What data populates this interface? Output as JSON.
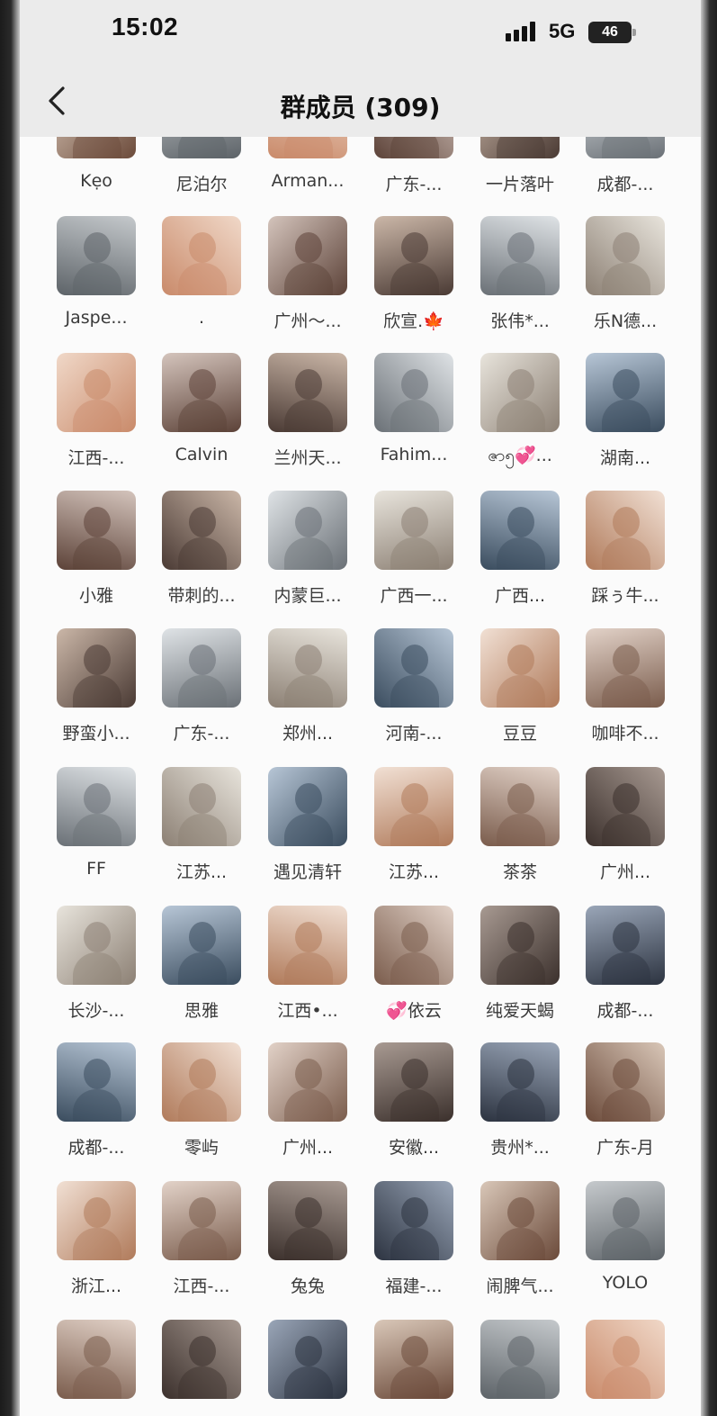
{
  "status_bar": {
    "time": "15:02",
    "network": "5G",
    "battery": "46"
  },
  "header": {
    "title": "群成员 (309)"
  },
  "colors": {
    "header_bg": "#ebebeb",
    "screen_bg": "#fbfbfb",
    "name_text": "#3a3a3a"
  },
  "members": [
    {
      "name": "Kẹo"
    },
    {
      "name": "尼泊尔"
    },
    {
      "name": "Arman..."
    },
    {
      "name": "广东-..."
    },
    {
      "name": "一片落叶"
    },
    {
      "name": "成都-..."
    },
    {
      "name": "Jaspe..."
    },
    {
      "name": "."
    },
    {
      "name": "广州～..."
    },
    {
      "name": "欣宣.🍁"
    },
    {
      "name": "张伟*..."
    },
    {
      "name": "乐N德..."
    },
    {
      "name": "江西-..."
    },
    {
      "name": "Calvin"
    },
    {
      "name": "兰州天..."
    },
    {
      "name": "Fahim..."
    },
    {
      "name": "ဇာ၅💞..."
    },
    {
      "name": "湖南..."
    },
    {
      "name": "小雅"
    },
    {
      "name": "带刺的..."
    },
    {
      "name": "内蒙巨..."
    },
    {
      "name": "广西一..."
    },
    {
      "name": "广西..."
    },
    {
      "name": "踩ぅ牛..."
    },
    {
      "name": "野蛮小..."
    },
    {
      "name": "广东-..."
    },
    {
      "name": "郑州..."
    },
    {
      "name": "河南-..."
    },
    {
      "name": "豆豆"
    },
    {
      "name": "咖啡不..."
    },
    {
      "name": "FF"
    },
    {
      "name": "江苏..."
    },
    {
      "name": "遇见清轩"
    },
    {
      "name": "江苏..."
    },
    {
      "name": "茶茶"
    },
    {
      "name": "广州..."
    },
    {
      "name": "长沙-..."
    },
    {
      "name": "思雅"
    },
    {
      "name": "江西•..."
    },
    {
      "name": "💞依云"
    },
    {
      "name": "纯爱天蝎"
    },
    {
      "name": "成都-..."
    },
    {
      "name": "成都-..."
    },
    {
      "name": "零屿"
    },
    {
      "name": "广州..."
    },
    {
      "name": "安徽..."
    },
    {
      "name": "贵州*..."
    },
    {
      "name": "广东-月"
    },
    {
      "name": "浙江..."
    },
    {
      "name": "江西-..."
    },
    {
      "name": "兔兔"
    },
    {
      "name": "福建-..."
    },
    {
      "name": "闹脾气..."
    },
    {
      "name": "YOLO"
    },
    {
      "name": ""
    },
    {
      "name": ""
    },
    {
      "name": ""
    },
    {
      "name": ""
    },
    {
      "name": ""
    },
    {
      "name": ""
    }
  ]
}
